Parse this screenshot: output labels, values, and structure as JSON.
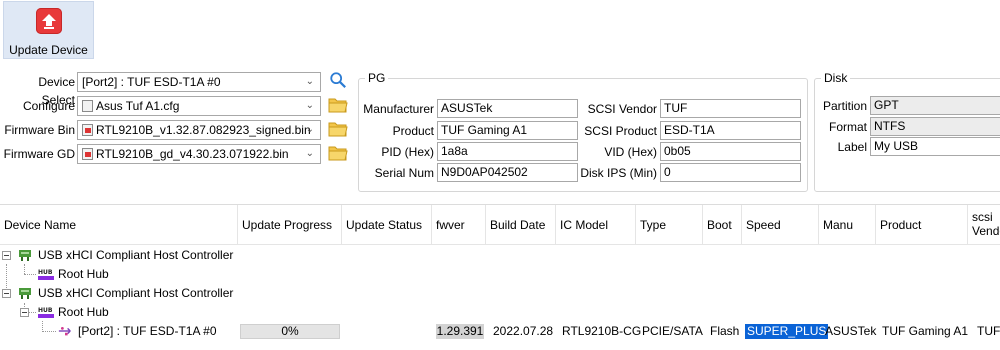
{
  "toolbar": {
    "update_label": "Update Device",
    "update_icon": "upload-arrow-icon",
    "accent": "#e8393a"
  },
  "device_select": {
    "label": "Device Select",
    "value": "[Port2] : TUF ESD-T1A #0"
  },
  "configure": {
    "label": "Configure",
    "value": "Asus Tuf A1.cfg"
  },
  "firmware_bin": {
    "label": "Firmware Bin",
    "value": "RTL9210B_v1.32.87.082923_signed.bin"
  },
  "firmware_gd": {
    "label": "Firmware GD",
    "value": "RTL9210B_gd_v4.30.23.071922.bin"
  },
  "pg": {
    "title": "PG",
    "manufacturer_label": "Manufacturer",
    "manufacturer": "ASUSTek",
    "product_label": "Product",
    "product": "TUF Gaming A1",
    "pid_label": "PID (Hex)",
    "pid": "1a8a",
    "serial_label": "Serial Num",
    "serial": "N9D0AP042502",
    "scsi_vendor_label": "SCSI Vendor",
    "scsi_vendor": "TUF",
    "scsi_product_label": "SCSI Product",
    "scsi_product": "ESD-T1A",
    "vid_label": "VID (Hex)",
    "vid": "0b05",
    "disk_ips_label": "Disk IPS (Min)",
    "disk_ips": "0"
  },
  "disk": {
    "title": "Disk",
    "partition_label": "Partition",
    "partition": "GPT",
    "format_label": "Format",
    "format": "NTFS",
    "label_label": "Label",
    "label": "My USB"
  },
  "grid": {
    "columns": {
      "device_name": "Device Name",
      "update_progress": "Update Progress",
      "update_status": "Update Status",
      "fwver": "fwver",
      "build_date": "Build Date",
      "ic_model": "IC Model",
      "type": "Type",
      "boot": "Boot",
      "speed": "Speed",
      "manu": "Manu",
      "product": "Product",
      "scsi_vendor_1": "scsi",
      "scsi_vendor_2": "Vendo"
    },
    "tree": {
      "controller1": "USB xHCI Compliant Host Controller",
      "hub1": "Root Hub",
      "controller2": "USB xHCI Compliant Host Controller",
      "hub2": "Root Hub",
      "device": "[Port2] : TUF ESD-T1A #0"
    },
    "device_row": {
      "progress_text": "0%",
      "progress": 0,
      "fwver": "1.29.391",
      "build_date": "2022.07.28",
      "ic_model": "RTL9210B-CG",
      "type": "PCIE/SATA",
      "boot": "Flash",
      "speed": "SUPER_PLUS",
      "manu": "ASUSTek",
      "product": "TUF Gaming A1",
      "scsi_vendor": "TUF"
    }
  }
}
